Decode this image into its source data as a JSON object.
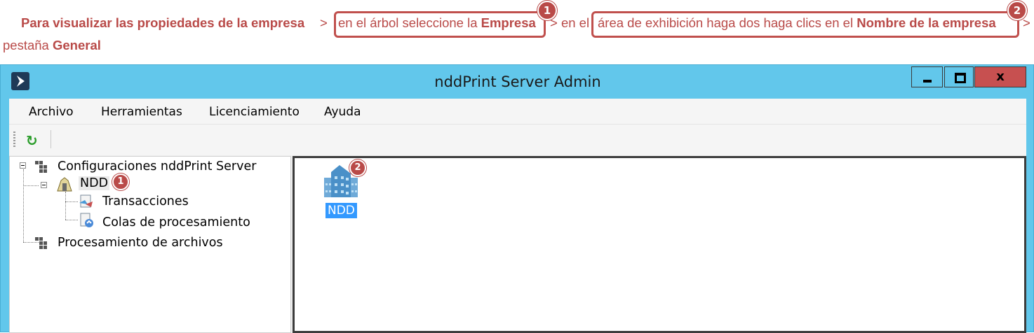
{
  "instruction": {
    "seg1": "Para visualizar las propiedades de la empresa",
    "sep1": ">",
    "seg2_pre": "en el árbol seleccione la ",
    "seg2_bold": "Empresa",
    "sep2": "> en el",
    "seg3_pre": "área de exhibición haga dos haga clics en el ",
    "seg3_bold": "Nombre de la empresa",
    "sep3": ">",
    "line2_pre": "pestaña ",
    "line2_bold": "General",
    "badge1": "1",
    "badge2": "2"
  },
  "window": {
    "title": "nddPrint Server Admin",
    "close_glyph": "x"
  },
  "menu": [
    "Archivo",
    "Herramientas",
    "Licenciamiento",
    "Ayuda"
  ],
  "toolbar": {
    "refresh_glyph": "↻"
  },
  "tree": {
    "root": "Configuraciones nddPrint Server",
    "company": "NDD",
    "transactions": "Transacciones",
    "queues": "Colas de procesamiento",
    "files": "Procesamiento de archivos"
  },
  "content": {
    "item_label": "NDD"
  },
  "colors": {
    "accent": "#b94a48",
    "titlebar": "#62c7eb",
    "close": "#c75050",
    "selection": "#3399ff"
  },
  "icons": [
    "app-logo-icon",
    "minimize-icon",
    "maximize-icon",
    "close-icon",
    "refresh-icon",
    "grid-icon",
    "building-icon",
    "transactions-icon",
    "queue-icon"
  ]
}
